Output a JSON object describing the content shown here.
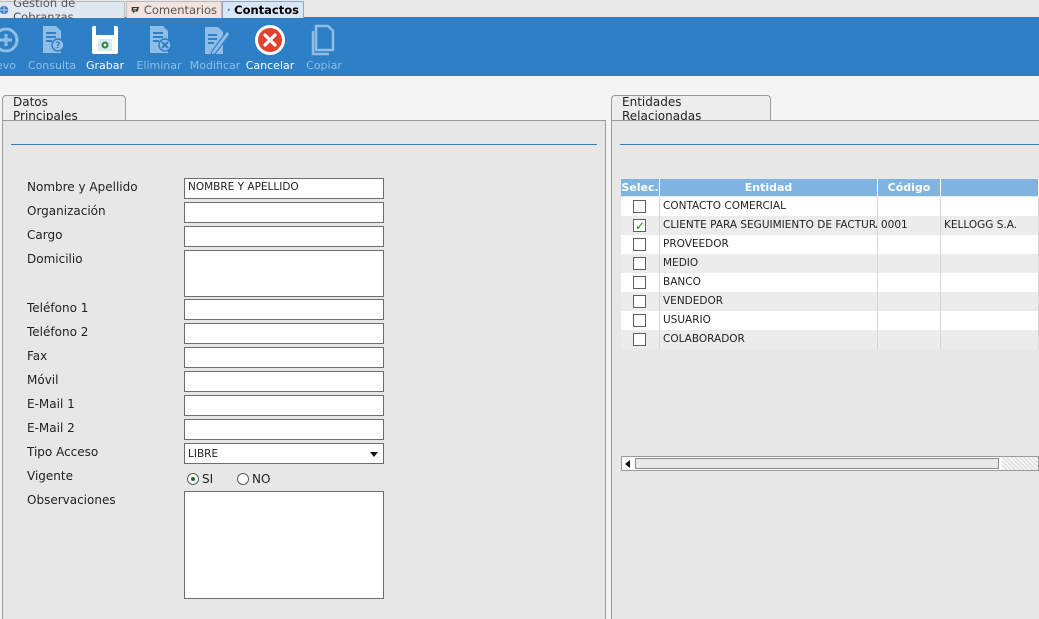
{
  "window_tabs": [
    {
      "label": "Gestión de Cobranzas",
      "icon": "globe-icon"
    },
    {
      "label": "Comentarios",
      "icon": "comment-icon"
    },
    {
      "label": "Contactos",
      "icon": "contact-icon"
    }
  ],
  "toolbar": {
    "nuevo": "evo",
    "consulta": "Consulta",
    "grabar": "Grabar",
    "eliminar": "Eliminar",
    "modificar": "Modificar",
    "cancelar": "Cancelar",
    "copiar": "Copiar"
  },
  "left_panel": {
    "tab_label": "Datos Principales",
    "labels": {
      "nombre": "Nombre y Apellido",
      "organizacion": "Organización",
      "cargo": "Cargo",
      "domicilio": "Domicilio",
      "telefono1": "Teléfono 1",
      "telefono2": "Teléfono 2",
      "fax": "Fax",
      "movil": "Móvil",
      "email1": "E-Mail 1",
      "email2": "E-Mail 2",
      "tipo_acceso": "Tipo Acceso",
      "vigente": "Vigente",
      "observaciones": "Observaciones"
    },
    "values": {
      "nombre": "NOMBRE Y APELLIDO",
      "organizacion": "",
      "cargo": "",
      "domicilio": "",
      "telefono1": "",
      "telefono2": "",
      "fax": "",
      "movil": "",
      "email1": "",
      "email2": "",
      "tipo_acceso": "LIBRE",
      "observaciones": ""
    },
    "vigente_options": {
      "si": "SI",
      "no": "NO",
      "selected": "SI"
    }
  },
  "right_panel": {
    "tab_label": "Entidades Relacionadas",
    "columns": {
      "selec": "Selec.",
      "entidad": "Entidad",
      "codigo": "Código",
      "extra": ""
    },
    "rows": [
      {
        "checked": false,
        "entidad": "CONTACTO COMERCIAL",
        "codigo": "",
        "extra": ""
      },
      {
        "checked": true,
        "entidad": "CLIENTE PARA SEGUIMIENTO DE FACTURAS",
        "codigo": "0001",
        "extra": "KELLOGG S.A."
      },
      {
        "checked": false,
        "entidad": "PROVEEDOR",
        "codigo": "",
        "extra": ""
      },
      {
        "checked": false,
        "entidad": "MEDIO",
        "codigo": "",
        "extra": ""
      },
      {
        "checked": false,
        "entidad": "BANCO",
        "codigo": "",
        "extra": ""
      },
      {
        "checked": false,
        "entidad": "VENDEDOR",
        "codigo": "",
        "extra": ""
      },
      {
        "checked": false,
        "entidad": "USUARIO",
        "codigo": "",
        "extra": ""
      },
      {
        "checked": false,
        "entidad": "COLABORADOR",
        "codigo": "",
        "extra": ""
      }
    ]
  },
  "colors": {
    "toolbar": "#2d7fc6",
    "grid_header": "#7fb3e0",
    "separator": "#3b79b5"
  }
}
